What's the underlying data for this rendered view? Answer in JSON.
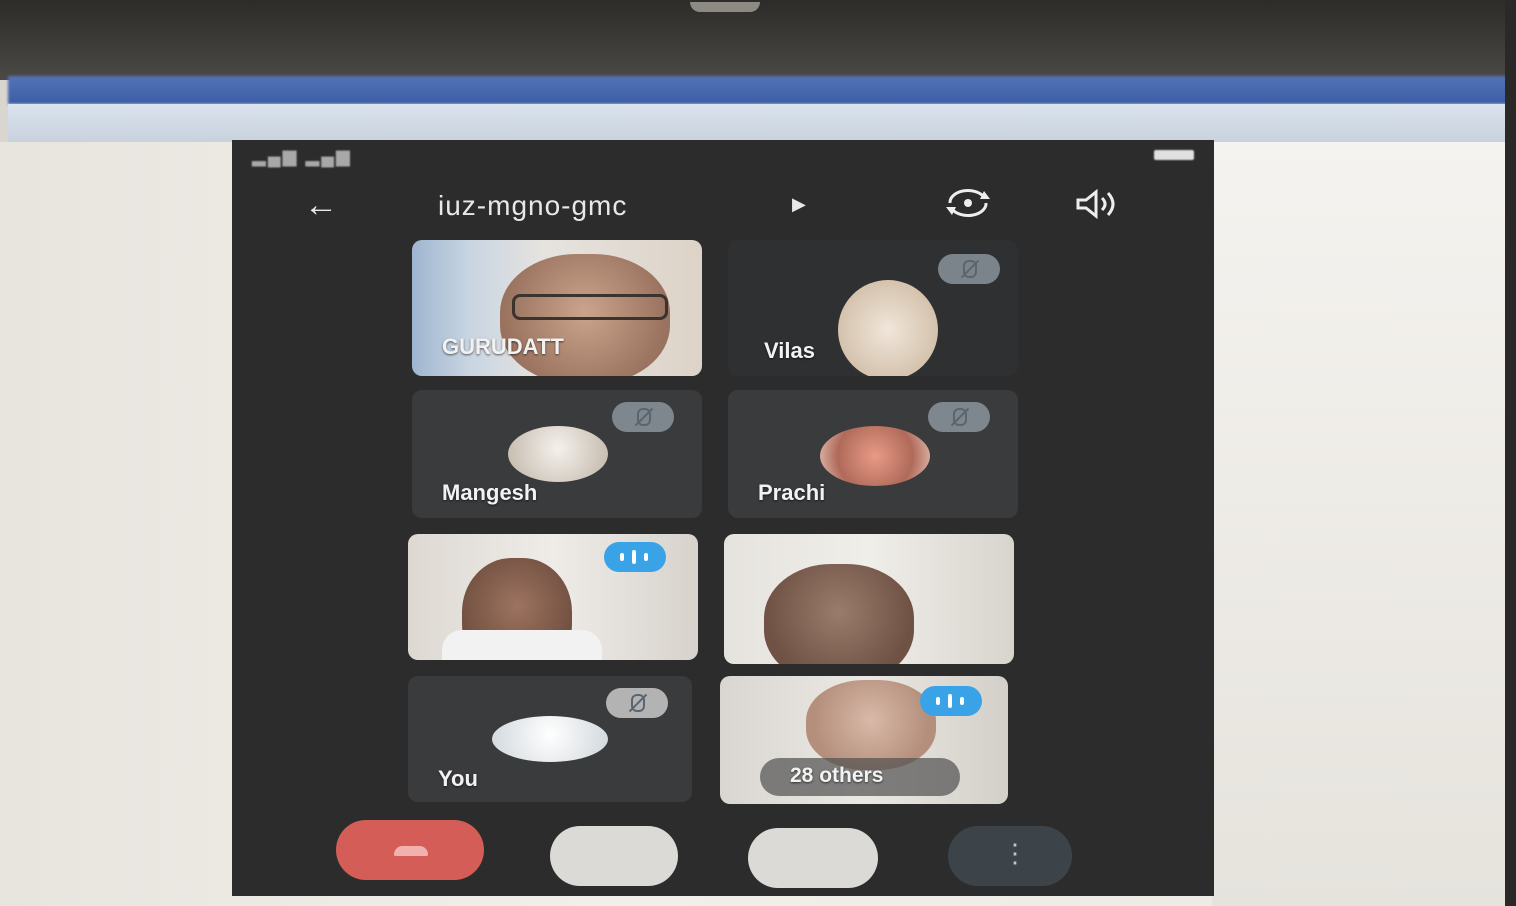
{
  "meeting": {
    "code": "iuz-mgno-gmc"
  },
  "participants": [
    {
      "name": "GURUDATT",
      "muted": false,
      "video": true
    },
    {
      "name": "Vilas",
      "muted": true,
      "video": false
    },
    {
      "name": "Mangesh",
      "muted": true,
      "video": false
    },
    {
      "name": "Prachi",
      "muted": true,
      "video": false
    },
    {
      "name": "",
      "muted": false,
      "video": true,
      "speaking": true
    },
    {
      "name": "",
      "muted": false,
      "video": true
    },
    {
      "name": "You",
      "muted": true,
      "video": false
    },
    {
      "name": "28 others",
      "muted": false,
      "video": true,
      "speaking": true
    }
  ],
  "colors": {
    "screen_bg": "#2c2c2c",
    "end_call": "#d45d57",
    "speaking": "#3aa3e8"
  },
  "icons": {
    "back": "arrow-left-icon",
    "switch_camera": "switch-camera-icon",
    "speaker": "speaker-icon",
    "mic_off": "mic-off-icon",
    "speaking": "speaking-indicator-icon",
    "more": "more-vert-icon"
  }
}
